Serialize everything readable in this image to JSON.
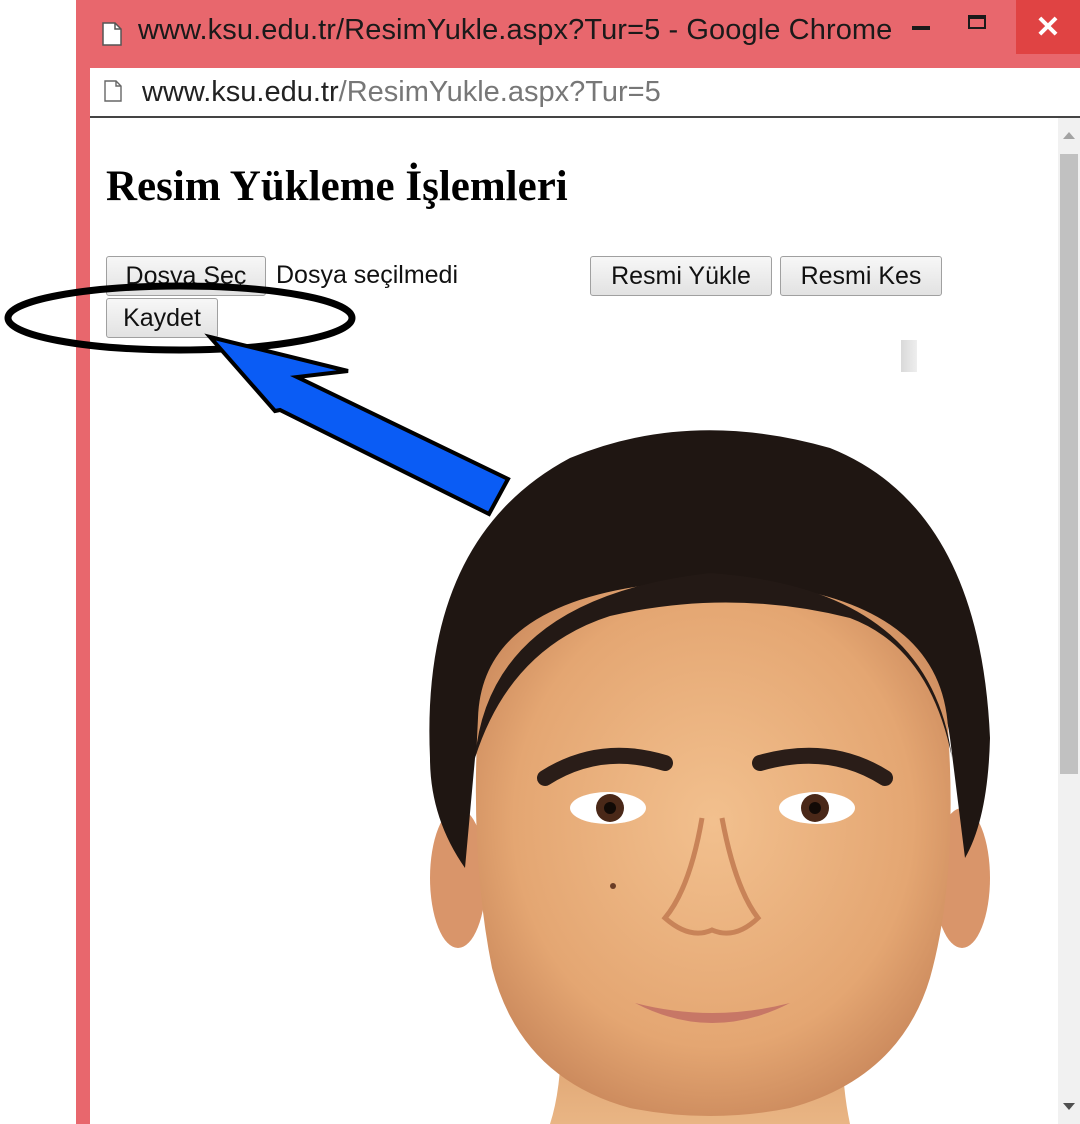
{
  "window": {
    "title": "www.ksu.edu.tr/ResimYukle.aspx?Tur=5 - Google Chrome",
    "close_glyph": "✕",
    "controls": [
      "minimize-icon",
      "maximize-icon",
      "close-icon"
    ]
  },
  "address": {
    "host": "www.ksu.edu.tr",
    "path": "/ResimYukle.aspx?Tur=5"
  },
  "page": {
    "title": "Resim Yükleme İşlemleri",
    "choose_file_label": "Dosya Seç",
    "no_file_text": "Dosya seçilmedi",
    "upload_label": "Resmi Yükle",
    "crop_label": "Resmi Kes",
    "save_label": "Kaydet"
  },
  "annotation": {
    "highlight_color": "#000000",
    "arrow_color": "#0a5cf5"
  },
  "colors": {
    "window_frame": "#e8676d",
    "close_button": "#e04343"
  }
}
